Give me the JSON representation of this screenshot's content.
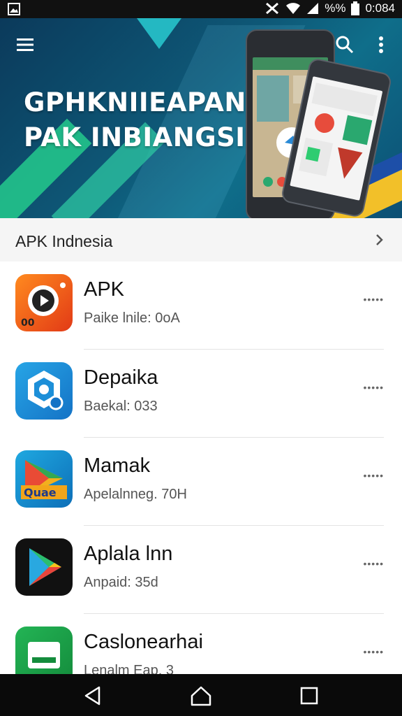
{
  "status_bar": {
    "battery_percent": "%%",
    "time": "0:084"
  },
  "banner": {
    "title_line1": "GPHKNIIEAPAN",
    "title_line2": "PAK INBIANGSI"
  },
  "section": {
    "title": "APK Indnesia"
  },
  "apps": [
    {
      "name": "APK",
      "meta": "Paike lnile: 0oA",
      "more": "•••••"
    },
    {
      "name": "Depaika",
      "meta": "Baekal: 033",
      "more": "•••••"
    },
    {
      "name": "Mamak",
      "meta": "Apelalnneg. 70H",
      "more": "•••••"
    },
    {
      "name": "Aplala lnn",
      "meta": "Anpaid: 35d",
      "more": "•••••"
    },
    {
      "name": "Caslonearhai",
      "meta": "Lenalm Eap. 3",
      "more": "•••••"
    }
  ],
  "icons": [
    "image-icon",
    "no-signal-icon",
    "wifi-icon",
    "signal-icon",
    "battery-icon",
    "menu-icon",
    "search-icon",
    "more-vert-icon",
    "chevron-right-icon",
    "back-icon",
    "home-icon",
    "recents-icon"
  ],
  "colors": {
    "banner": "#0e5877",
    "accent_green": "#22c38b",
    "accent_yellow": "#f2c029"
  }
}
